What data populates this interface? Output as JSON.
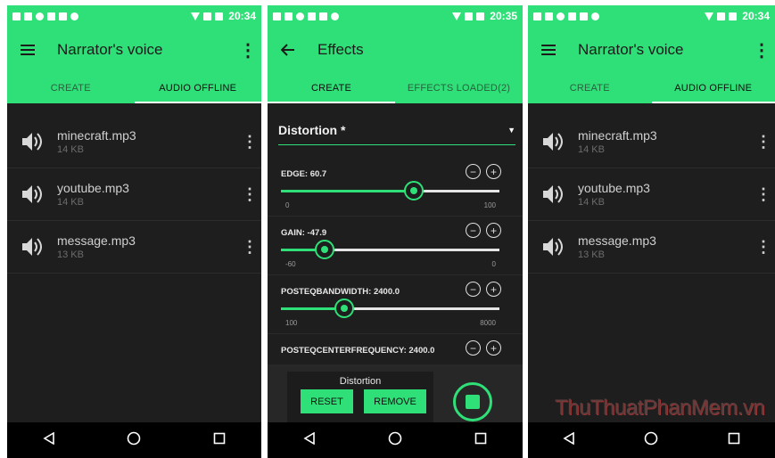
{
  "colors": {
    "accent": "#2ee077",
    "background": "#1e1e1e",
    "navbar": "#000000"
  },
  "screens": [
    {
      "status_time": "20:34",
      "toolbar": {
        "title": "Narrator's voice",
        "left_icon": "menu-icon",
        "right_icon": "more-vert-icon"
      },
      "tabs": [
        {
          "label": "CREATE",
          "active": false
        },
        {
          "label": "AUDIO OFFLINE",
          "active": true
        }
      ],
      "files": [
        {
          "name": "minecraft.mp3",
          "size": "14 KB"
        },
        {
          "name": "youtube.mp3",
          "size": "14 KB"
        },
        {
          "name": "message.mp3",
          "size": "13 KB"
        }
      ]
    },
    {
      "status_time": "20:35",
      "toolbar": {
        "title": "Effects",
        "left_icon": "back-arrow-icon"
      },
      "tabs": [
        {
          "label": "CREATE",
          "active": true
        },
        {
          "label": "EFFECTS LOADED(2)",
          "active": false
        }
      ],
      "effect_select": {
        "value": "Distortion *"
      },
      "params": [
        {
          "label": "EDGE: 60.7",
          "min_label": "0",
          "max_label": "100",
          "level": 0.607
        },
        {
          "label": "GAIN: -47.9",
          "min_label": "-60",
          "max_label": "0",
          "level": 0.2
        },
        {
          "label": "POSTEQBANDWIDTH: 2400.0",
          "min_label": "100",
          "max_label": "8000",
          "level": 0.29
        },
        {
          "label": "POSTEQCENTERFREQUENCY: 2400.0"
        }
      ],
      "bottom_panel": {
        "title": "Distortion",
        "reset_label": "RESET",
        "remove_label": "REMOVE"
      }
    },
    {
      "status_time": "20:34",
      "toolbar": {
        "title": "Narrator's voice",
        "left_icon": "menu-icon",
        "right_icon": "more-vert-icon"
      },
      "tabs": [
        {
          "label": "CREATE",
          "active": false
        },
        {
          "label": "AUDIO OFFLINE",
          "active": true
        }
      ],
      "files": [
        {
          "name": "minecraft.mp3",
          "size": "14 KB"
        },
        {
          "name": "youtube.mp3",
          "size": "14 KB"
        },
        {
          "name": "message.mp3",
          "size": "13 KB"
        }
      ]
    }
  ],
  "watermark": "ThuThuatPhanMem.vn"
}
